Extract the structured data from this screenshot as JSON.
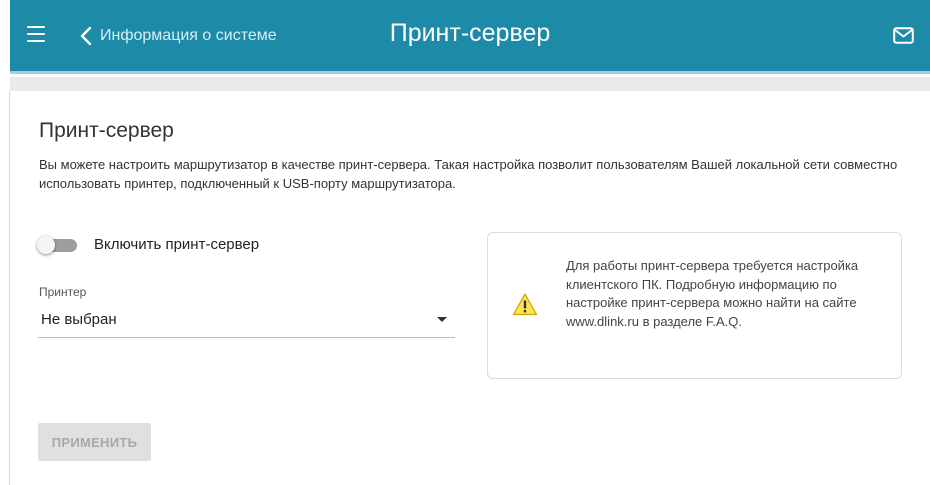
{
  "header": {
    "back_label": "Информация о системе",
    "title": "Принт-сервер",
    "icons": {
      "menu": "hamburger-menu-icon",
      "back": "chevron-left-icon",
      "mail": "envelope-icon"
    },
    "bg_color": "#1d8aa7"
  },
  "main": {
    "section_title": "Принт-сервер",
    "description": "Вы можете настроить маршрутизатор в качестве принт-сервера. Такая настройка позволит пользователям Вашей локальной сети совместно использовать принтер, подключенный к USB-порту маршрутизатора.",
    "toggle": {
      "label": "Включить принт-сервер",
      "state": "off"
    },
    "printer_field": {
      "label": "Принтер",
      "value": "Не выбран"
    },
    "info": {
      "icon": "warning-icon",
      "text": "Для работы принт-сервера требуется настройка клиентского ПК. Подробную информацию по настройке принт-сервера можно найти на сайте www.dlink.ru в разделе F.A.Q."
    },
    "apply_button": {
      "label": "ПРИМЕНИТЬ",
      "disabled": true
    }
  }
}
